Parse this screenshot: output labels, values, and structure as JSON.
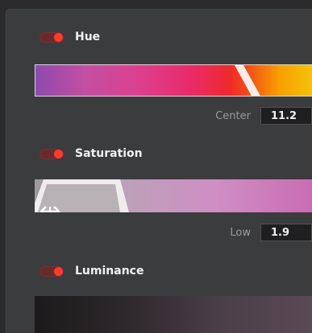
{
  "hue": {
    "title": "Hue",
    "enabled": true,
    "value_label": "Center",
    "value": "11.2"
  },
  "saturation": {
    "title": "Saturation",
    "enabled": true,
    "value_label": "Low",
    "value": "1.9"
  },
  "luminance": {
    "title": "Luminance",
    "enabled": true
  },
  "colors": {
    "toggle_on": "#ff3b2f",
    "panel_bg": "#3b3c3e",
    "value_box_bg": "#1f1f21"
  },
  "icons": {
    "drag_handle": "horizontal-resize-arrows"
  }
}
